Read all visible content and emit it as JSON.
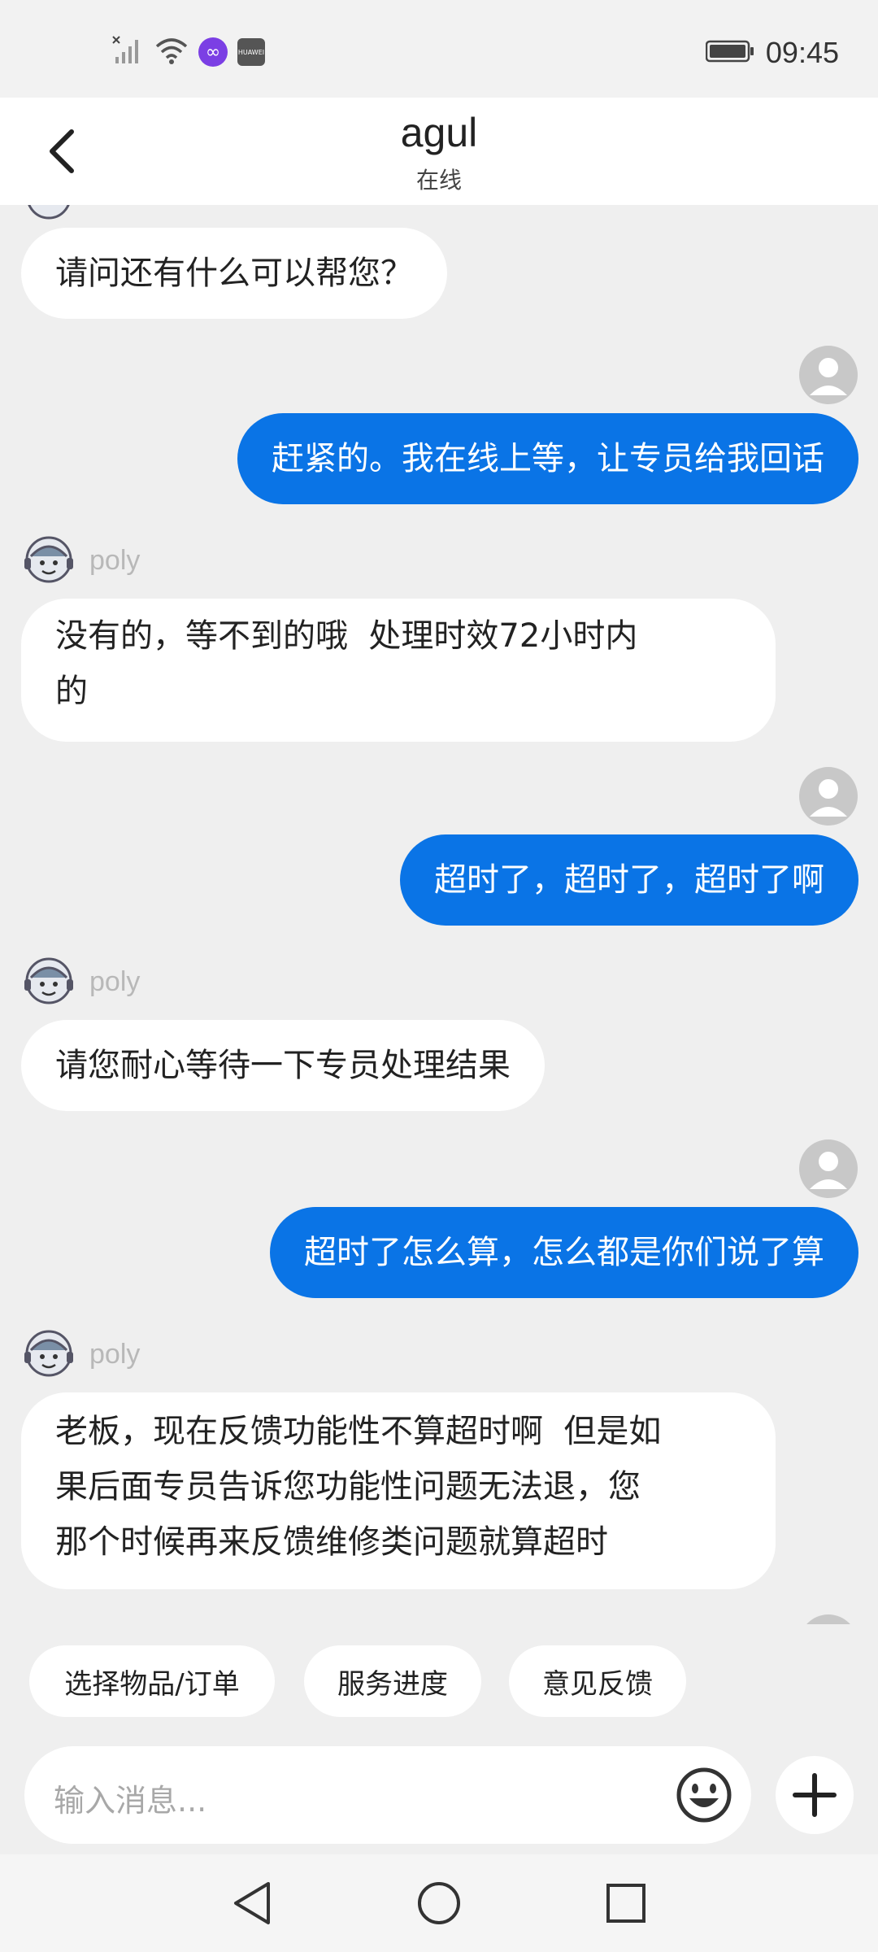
{
  "status_bar": {
    "time": "09:45",
    "icons": [
      "signal-off-icon",
      "wifi-icon",
      "infinity-app-icon",
      "huawei-app-icon",
      "battery-icon"
    ],
    "app_badge_text": "HUAWEI"
  },
  "header": {
    "title": "agul",
    "subtitle": "在线"
  },
  "agent": {
    "name": "poly"
  },
  "messages": [
    {
      "from": "agent",
      "text": "请问还有什么可以帮您？"
    },
    {
      "from": "user",
      "text": "赶紧的。我在线上等，让专员给我回话"
    },
    {
      "from": "agent",
      "name": "poly",
      "lines": [
        "没有的，等不到的哦  处理时效72小时内",
        "的"
      ]
    },
    {
      "from": "user",
      "text": "超时了，超时了，超时了啊"
    },
    {
      "from": "agent",
      "name": "poly",
      "text": "请您耐心等待一下专员处理结果"
    },
    {
      "from": "user",
      "text": "超时了怎么算，怎么都是你们说了算"
    },
    {
      "from": "agent",
      "name": "poly",
      "lines": [
        "老板，现在反馈功能性不算超时啊  但是如",
        "果后面专员告诉您功能性问题无法退，您",
        "那个时候再来反馈维修类问题就算超时"
      ]
    }
  ],
  "quick_replies": [
    "选择物品/订单",
    "服务进度",
    "意见反馈"
  ],
  "input": {
    "placeholder": "输入消息..."
  },
  "colors": {
    "user_bubble": "#0a74e6",
    "agent_bubble": "#ffffff",
    "background": "#efefef"
  }
}
